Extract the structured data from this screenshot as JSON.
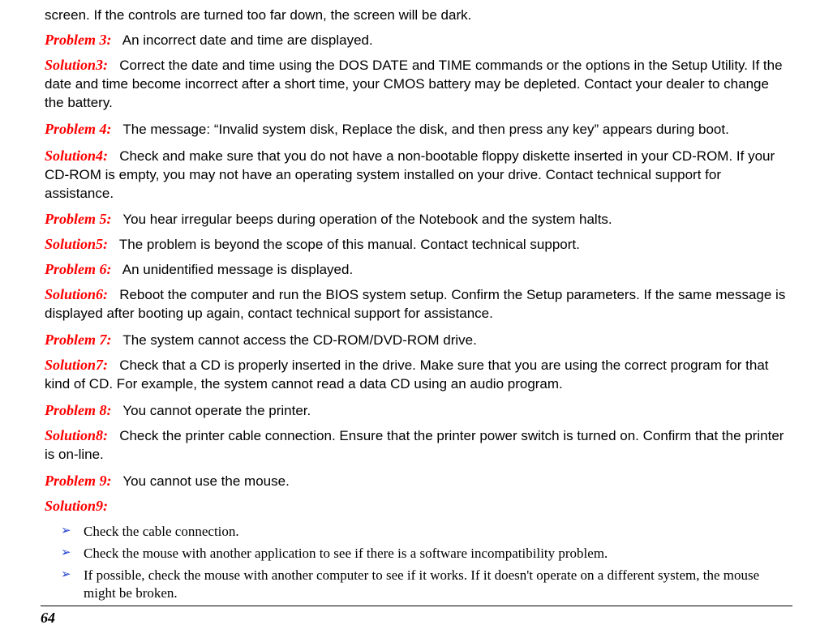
{
  "lines": {
    "l0": "screen.  If the controls are turned too far down, the screen will be dark.",
    "p3_label": "Problem 3:",
    "p3_text": "An incorrect date and time are displayed.",
    "s3_label": "Solution3:",
    "s3_text": "Correct the date and time using the DOS DATE and TIME commands or the options in the Setup Utility.  If the date and time become incorrect after a short time, your CMOS battery may be depleted.  Contact your dealer to change the battery.",
    "p4_label": "Problem 4:",
    "p4_text": "The message: “Invalid system disk, Replace the disk, and then press any key”  appears during boot.",
    "s4_label": "Solution4:",
    "s4_text": "Check and make sure that you do not have a non-bootable floppy diskette inserted in your CD-ROM.  If your CD-ROM is empty, you may not have an operating system installed on your drive.  Contact technical support for assistance.",
    "p5_label": "Problem 5:",
    "p5_text": "You hear irregular beeps during operation of the Notebook and the system halts.",
    "s5_label": "Solution5:",
    "s5_text": "The problem is beyond the scope of this manual.  Contact technical support.",
    "p6_label": "Problem 6:",
    "p6_text": "An unidentified message is displayed.",
    "s6_label": "Solution6:",
    "s6_text": "Reboot the computer and run the BIOS system setup.  Confirm the Setup parameters.  If the same message is displayed after booting up again, contact technical support for assistance.",
    "p7_label": "Problem 7:",
    "p7_text": "The system cannot access the CD-ROM/DVD-ROM drive.",
    "s7_label": "Solution7:",
    "s7_text": "Check that a CD is properly inserted in the drive.  Make sure that you are using the correct program for that kind of CD.  For example, the system cannot read a data CD using an audio program.",
    "p8_label": "Problem 8:",
    "p8_text": "You cannot operate the printer.",
    "s8_label": "Solution8:",
    "s8_text": "Check the printer cable connection.  Ensure that the printer power switch is turned on.  Confirm that the printer is on-line.",
    "p9_label": "Problem 9:",
    "p9_text": "You cannot use the mouse.",
    "s9_label": "Solution9:"
  },
  "bullets": {
    "b1": "Check the cable connection.",
    "b2": "Check the mouse with another application to see if there is a software incompatibility problem.",
    "b3": "If possible, check the mouse with another computer to see if it works.  If it doesn't operate on a different system, the mouse might be broken."
  },
  "page_number": "64"
}
